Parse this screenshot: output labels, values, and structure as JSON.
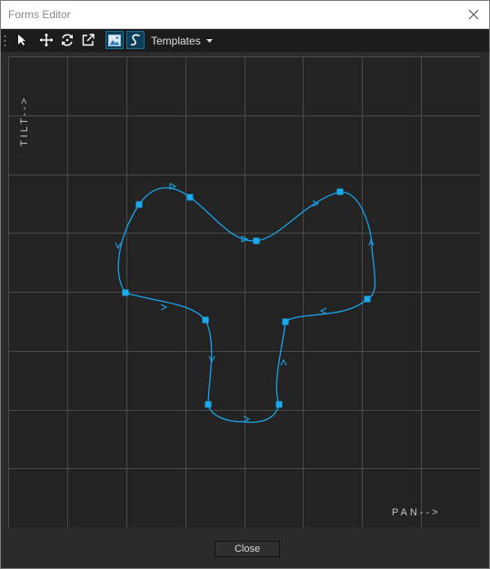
{
  "window": {
    "title": "Forms Editor"
  },
  "toolbar": {
    "tools": [
      {
        "icon": "select-arrow-icon",
        "active": false
      },
      {
        "icon": "move-icon",
        "active": false
      },
      {
        "icon": "rotate-icon",
        "active": false
      },
      {
        "icon": "external-open-icon",
        "active": false
      },
      {
        "icon": "image-icon",
        "active": true
      },
      {
        "icon": "curve-s-icon",
        "active": true
      }
    ],
    "templates_label": "Templates"
  },
  "editor": {
    "tilt_label": "TILT-->",
    "pan_label": "PAN-->",
    "grid": {
      "columns": 8,
      "rows": 8,
      "visible": true
    },
    "colors": {
      "background": "#232323",
      "grid": "#4a4a4a",
      "path": "#1aa3e8",
      "point": "#19a9ee"
    },
    "control_points": [
      {
        "id": 1,
        "label": ""
      },
      {
        "id": 2,
        "label": ""
      },
      {
        "id": 3,
        "label": ""
      },
      {
        "id": 4,
        "label": ""
      },
      {
        "id": 5,
        "label": ""
      },
      {
        "id": 6,
        "label": ""
      },
      {
        "id": 7,
        "label": ""
      },
      {
        "id": 8,
        "label": ""
      },
      {
        "id": 9,
        "label": ""
      },
      {
        "id": 10,
        "label": ""
      }
    ]
  },
  "footer": {
    "close_label": "Close"
  }
}
